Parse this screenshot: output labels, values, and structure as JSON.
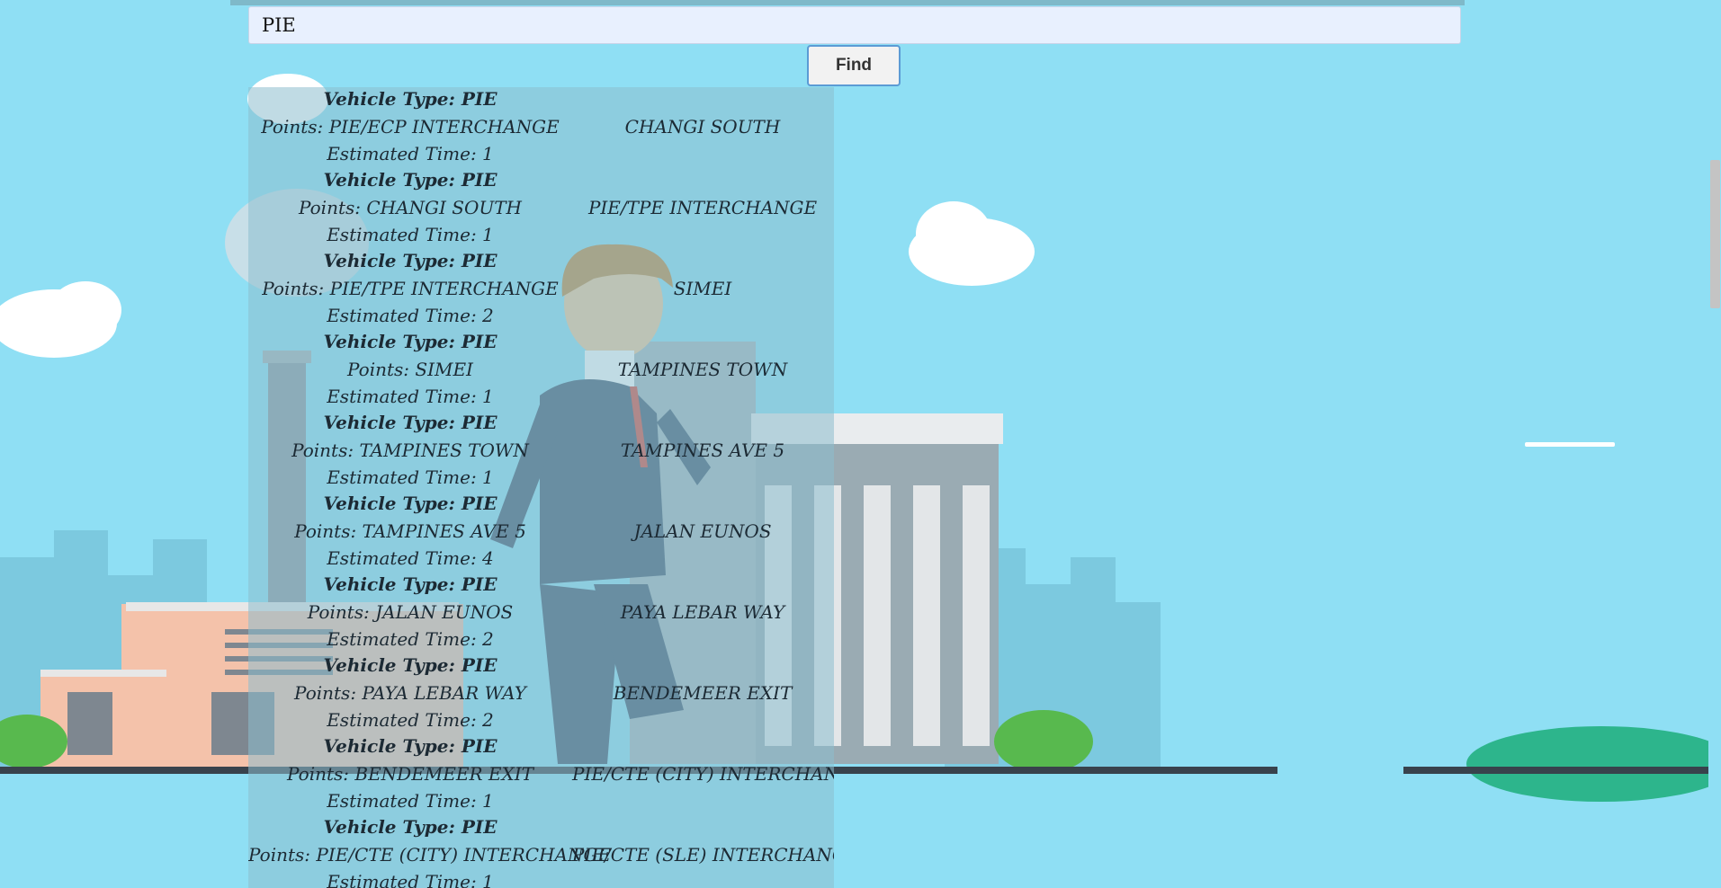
{
  "search": {
    "value": "PIE"
  },
  "find_label": "Find",
  "results": [
    {
      "vehicle": "Vehicle Type: PIE",
      "points": "Points: PIE/ECP INTERCHANGE",
      "to": "CHANGI SOUTH",
      "time": "Estimated Time: 1"
    },
    {
      "vehicle": "Vehicle Type: PIE",
      "points": "Points: CHANGI SOUTH",
      "to": "PIE/TPE INTERCHANGE",
      "time": "Estimated Time: 1"
    },
    {
      "vehicle": "Vehicle Type: PIE",
      "points": "Points: PIE/TPE INTERCHANGE",
      "to": "SIMEI",
      "time": "Estimated Time: 2"
    },
    {
      "vehicle": "Vehicle Type: PIE",
      "points": "Points: SIMEI",
      "to": "TAMPINES TOWN",
      "time": "Estimated Time: 1"
    },
    {
      "vehicle": "Vehicle Type: PIE",
      "points": "Points: TAMPINES TOWN",
      "to": "TAMPINES AVE 5",
      "time": "Estimated Time: 1"
    },
    {
      "vehicle": "Vehicle Type: PIE",
      "points": "Points: TAMPINES AVE 5",
      "to": "JALAN EUNOS",
      "time": "Estimated Time: 4"
    },
    {
      "vehicle": "Vehicle Type: PIE",
      "points": "Points: JALAN EUNOS",
      "to": "PAYA LEBAR WAY",
      "time": "Estimated Time: 2"
    },
    {
      "vehicle": "Vehicle Type: PIE",
      "points": "Points: PAYA LEBAR WAY",
      "to": "BENDEMEER EXIT",
      "time": "Estimated Time: 2"
    },
    {
      "vehicle": "Vehicle Type: PIE",
      "points": "Points: BENDEMEER EXIT",
      "to": "PIE/CTE (CITY) INTERCHANGE",
      "time": "Estimated Time: 1"
    },
    {
      "vehicle": "Vehicle Type: PIE",
      "points": "Points: PIE/CTE (CITY) INTERCHANGE",
      "to": "PIE/CTE (SLE) INTERCHANGE",
      "time": "Estimated Time: 1"
    }
  ]
}
